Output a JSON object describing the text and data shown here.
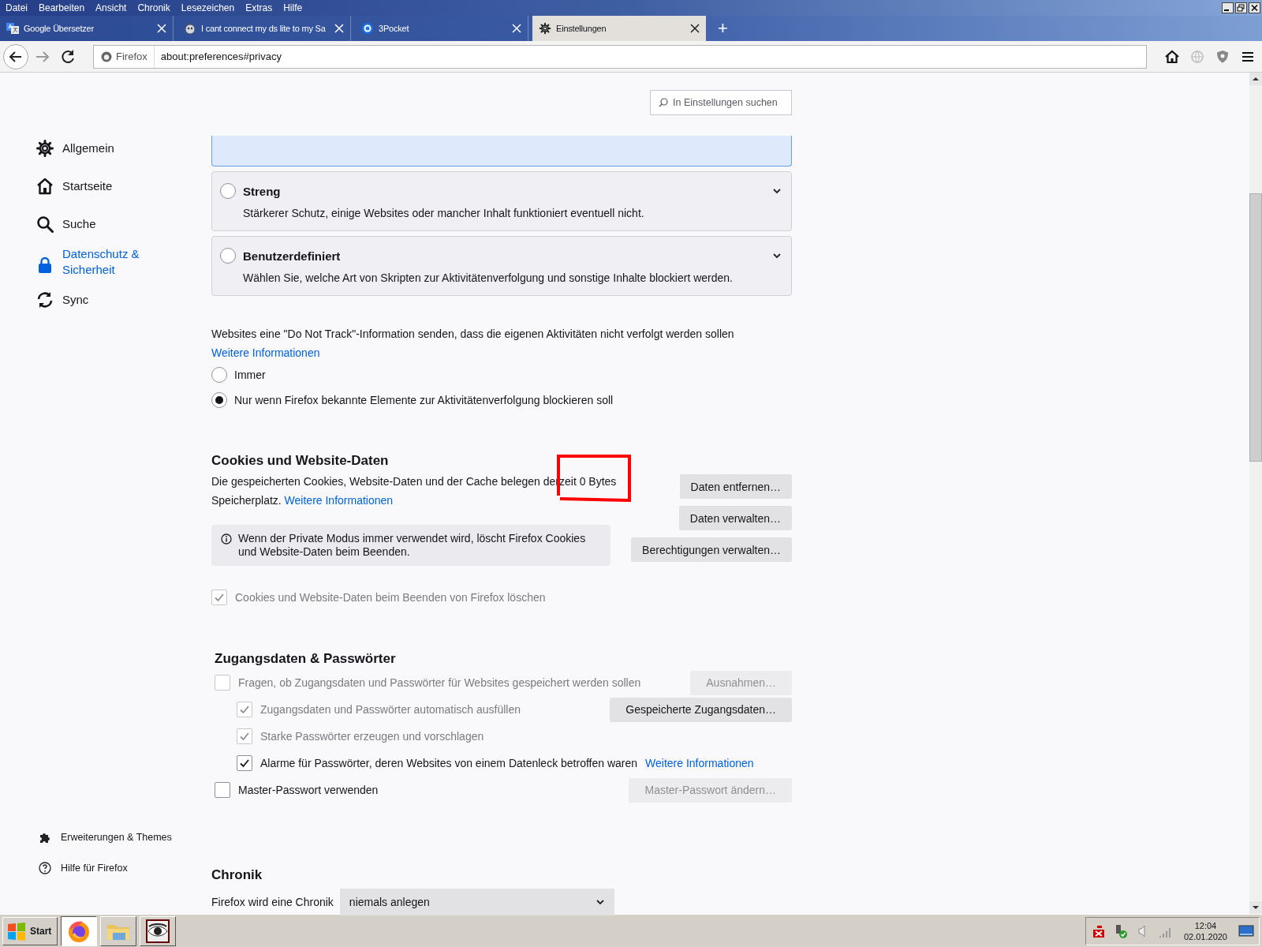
{
  "menu_bar": [
    "Datei",
    "Bearbeiten",
    "Ansicht",
    "Chronik",
    "Lesezeichen",
    "Extras",
    "Hilfe"
  ],
  "tabs": [
    {
      "title": "Google Übersetzer",
      "kind": "translate",
      "selected": false
    },
    {
      "title": "I cant connect my ds lite to my Sa",
      "kind": "forum",
      "selected": false
    },
    {
      "title": "3Pocket",
      "kind": "pocket",
      "selected": false
    },
    {
      "title": "Einstellungen",
      "kind": "settings",
      "selected": true
    }
  ],
  "new_tab": "+",
  "url_bar": {
    "identity": "Firefox",
    "url": "about:preferences#privacy"
  },
  "search": {
    "placeholder": "In Einstellungen suchen"
  },
  "sidebar": {
    "items": [
      {
        "label": "Allgemein",
        "kind": "gear",
        "selected": false
      },
      {
        "label": "Startseite",
        "kind": "home",
        "selected": false
      },
      {
        "label": "Suche",
        "kind": "search",
        "selected": false
      },
      {
        "label": "Datenschutz & Sicherheit",
        "kind": "lock",
        "selected": true
      },
      {
        "label": "Sync",
        "kind": "sync",
        "selected": false
      }
    ],
    "footer": [
      {
        "label": "Erweiterungen & Themes",
        "kind": "puzzle"
      },
      {
        "label": "Hilfe für Firefox",
        "kind": "help"
      }
    ]
  },
  "tracking_options": [
    {
      "title": "Streng",
      "description": "Stärkerer Schutz, einige Websites oder mancher Inhalt funktioniert eventuell nicht.",
      "selected": false
    },
    {
      "title": "Benutzerdefiniert",
      "description": "Wählen Sie, welche Art von Skripten zur Aktivitätenverfolgung und sonstige Inhalte blockiert werden.",
      "selected": false
    }
  ],
  "do_not_track": {
    "text": "Websites eine \"Do Not Track\"-Information senden, dass die eigenen Aktivitäten nicht verfolgt werden sollen",
    "link": "Weitere Informationen",
    "options": [
      {
        "label": "Immer",
        "selected": false
      },
      {
        "label": "Nur wenn Firefox bekannte Elemente zur Aktivitätenverfolgung blockieren soll",
        "selected": true
      }
    ]
  },
  "cookies": {
    "heading": "Cookies und Website-Daten",
    "text": "Die gespeicherten Cookies, Website-Daten und der Cache belegen derzeit 0 Bytes Speicherplatz.",
    "link": "Weitere Informationen",
    "buttons": [
      {
        "label": "Daten entfernen…"
      },
      {
        "label": "Daten verwalten…"
      },
      {
        "label": "Berechtigungen verwalten…"
      }
    ],
    "info": "Wenn der Private Modus immer verwendet wird, löscht Firefox Cookies und Website-Daten beim Beenden.",
    "delete_on_close": {
      "label": "Cookies und Website-Daten beim Beenden von Firefox löschen",
      "checked": true,
      "disabled": true
    }
  },
  "logins": {
    "heading": "Zugangsdaten & Passwörter",
    "rows": [
      {
        "label": "Fragen, ob Zugangsdaten und Passwörter für Websites gespeichert werden sollen",
        "checked": false,
        "disabled": true,
        "button": {
          "label": "Ausnahmen…",
          "disabled": true
        },
        "children": [
          {
            "label": "Zugangsdaten und Passwörter automatisch ausfüllen",
            "checked": true,
            "disabled": true,
            "button": {
              "label": "Gespeicherte Zugangsdaten…",
              "disabled": false
            }
          },
          {
            "label": "Starke Passwörter erzeugen und vorschlagen",
            "checked": true,
            "disabled": true
          },
          {
            "label": "Alarme für Passwörter, deren Websites von einem Datenleck betroffen waren",
            "checked": true,
            "disabled": false,
            "link": "Weitere Informationen"
          }
        ]
      },
      {
        "label": "Master-Passwort verwenden",
        "checked": false,
        "disabled": false,
        "button": {
          "label": "Master-Passwort ändern…",
          "disabled": true
        }
      }
    ]
  },
  "history": {
    "heading": "Chronik",
    "label": "Firefox wird eine Chronik",
    "value": "niemals anlegen"
  },
  "taskbar": {
    "start": "Start",
    "apps": [
      {
        "kind": "firefox",
        "selected": true
      },
      {
        "kind": "folder",
        "selected": false
      },
      {
        "kind": "eye",
        "selected": false
      }
    ],
    "time": "12:04",
    "date": "02.01.2020"
  }
}
